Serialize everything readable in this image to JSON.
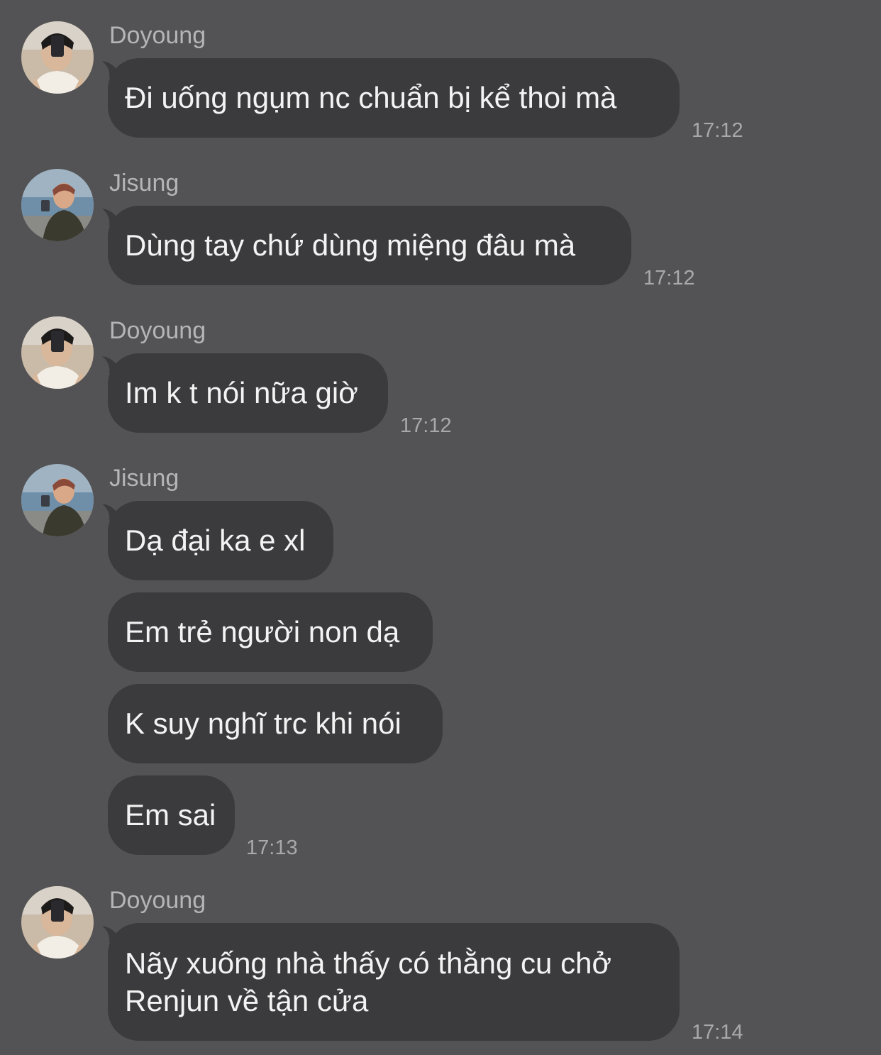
{
  "messages": [
    {
      "sender": "Doyoung",
      "bubbles": [
        "Đi uống ngụm nc chuẩn bị kể thoi mà"
      ],
      "time": "17:12"
    },
    {
      "sender": "Jisung",
      "bubbles": [
        "Dùng tay chứ dùng miệng đâu mà"
      ],
      "time": "17:12"
    },
    {
      "sender": "Doyoung",
      "bubbles": [
        "Im k t nói nữa giờ"
      ],
      "time": "17:12"
    },
    {
      "sender": "Jisung",
      "bubbles": [
        "Dạ đại ka e xl",
        "Em trẻ người non dạ",
        "K suy nghĩ trc khi nói",
        "Em sai"
      ],
      "time": "17:13"
    },
    {
      "sender": "Doyoung",
      "bubbles": [
        "Nãy xuống nhà thấy có thằng cu chở",
        "Renjun về tận cửa"
      ],
      "time": "17:14"
    }
  ],
  "colors": {
    "background": "#535254",
    "bubble": "#3b3a3d",
    "bubble_text": "#f3f3f3",
    "sender_text": "#b5b4b7",
    "time_text": "#a9a8ab"
  },
  "icons": {
    "doyoung_avatar": "user-photo-avatar",
    "jisung_avatar": "user-photo-avatar"
  }
}
